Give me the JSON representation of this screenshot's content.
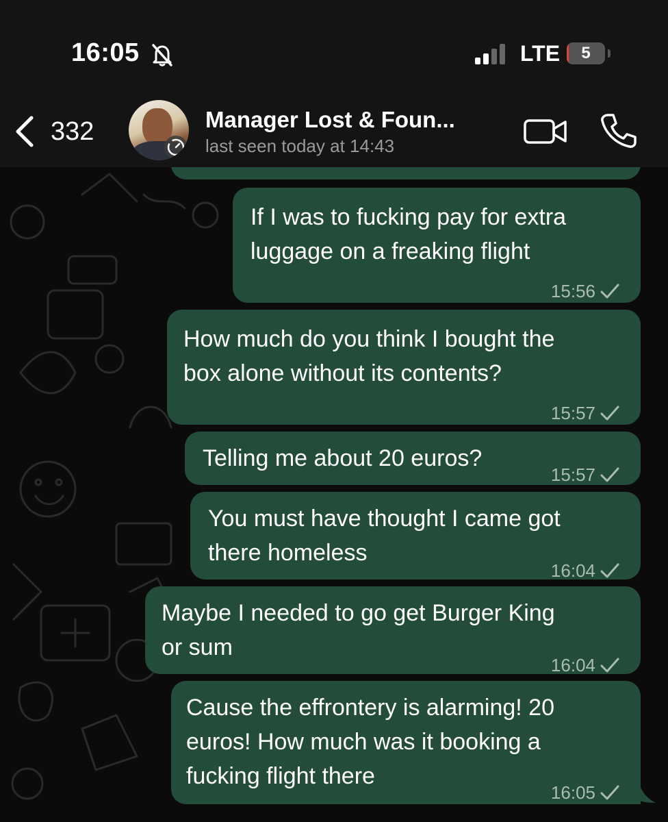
{
  "status_bar": {
    "time": "16:05",
    "network": "LTE",
    "battery": "5",
    "battery_level_percent": 5,
    "icons": [
      "bell-slash-icon",
      "signal-icon",
      "battery-icon"
    ]
  },
  "header": {
    "back_count": "332",
    "contact_name": "Manager Lost & Foun...",
    "last_seen": "last seen today at 14:43",
    "icons": [
      "back-chevron-icon",
      "avatar",
      "video-call-icon",
      "phone-icon"
    ]
  },
  "messages": [
    {
      "text": "If I was to fucking pay for extra\nluggage on a freaking flight",
      "time": "15:56",
      "status": "sent"
    },
    {
      "text": "How much do you think I bought the\nbox alone without its contents?",
      "time": "15:57",
      "status": "sent"
    },
    {
      "text": "Telling me about 20 euros?",
      "time": "15:57",
      "status": "sent"
    },
    {
      "text": "You must have thought I came got\nthere homeless",
      "time": "16:04",
      "status": "sent"
    },
    {
      "text": "Maybe I needed to go get Burger King\nor sum",
      "time": "16:04",
      "status": "sent"
    },
    {
      "text": "Cause the effrontery is alarming! 20\neuros! How much was it booking a\nfucking flight there",
      "time": "16:05",
      "status": "sent"
    }
  ],
  "colors": {
    "bubble_outgoing": "#244c3a",
    "background": "#0b0b0b",
    "header": "#141414",
    "battery_low": "#e0413b"
  }
}
